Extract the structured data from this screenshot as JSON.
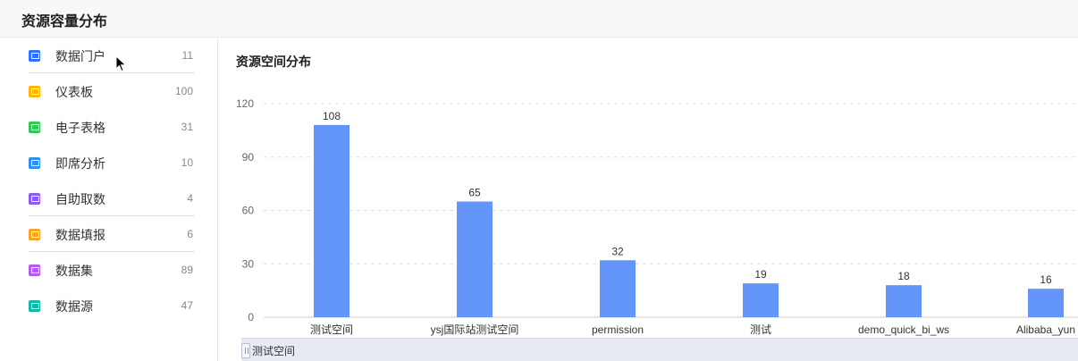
{
  "header": {
    "title": "资源容量分布"
  },
  "sidebar": {
    "items": [
      {
        "label": "数据门户",
        "count": "11",
        "color": "#3370ff",
        "icon": "portal-icon"
      },
      {
        "label": "仪表板",
        "count": "100",
        "color": "#ffb800",
        "icon": "dashboard-icon"
      },
      {
        "label": "电子表格",
        "count": "31",
        "color": "#34c759",
        "icon": "spreadsheet-icon"
      },
      {
        "label": "即席分析",
        "count": "10",
        "color": "#2e8ff0",
        "icon": "adhoc-analysis-icon"
      },
      {
        "label": "自助取数",
        "count": "4",
        "color": "#8a5cf5",
        "icon": "self-service-fetch-icon"
      },
      {
        "label": "数据填报",
        "count": "6",
        "color": "#f5a623",
        "icon": "data-entry-icon"
      },
      {
        "label": "数据集",
        "count": "89",
        "color": "#b45cf0",
        "icon": "dataset-icon"
      },
      {
        "label": "数据源",
        "count": "47",
        "color": "#14b8a6",
        "icon": "datasource-icon"
      }
    ]
  },
  "panel": {
    "title": "资源空间分布"
  },
  "chart_data": {
    "type": "bar",
    "categories": [
      "测试空间",
      "ysj国际站测试空间",
      "permission",
      "测试",
      "demo_quick_bi_ws",
      "Alibaba_yun"
    ],
    "values": [
      108,
      65,
      32,
      19,
      18,
      16
    ],
    "ylim": [
      0,
      120
    ],
    "yticks": [
      0,
      30,
      60,
      90,
      120
    ],
    "grid": true,
    "bar_color": "#6395fa",
    "title": "",
    "xlabel": "",
    "ylabel": ""
  },
  "slider": {
    "label": "测试空间"
  }
}
